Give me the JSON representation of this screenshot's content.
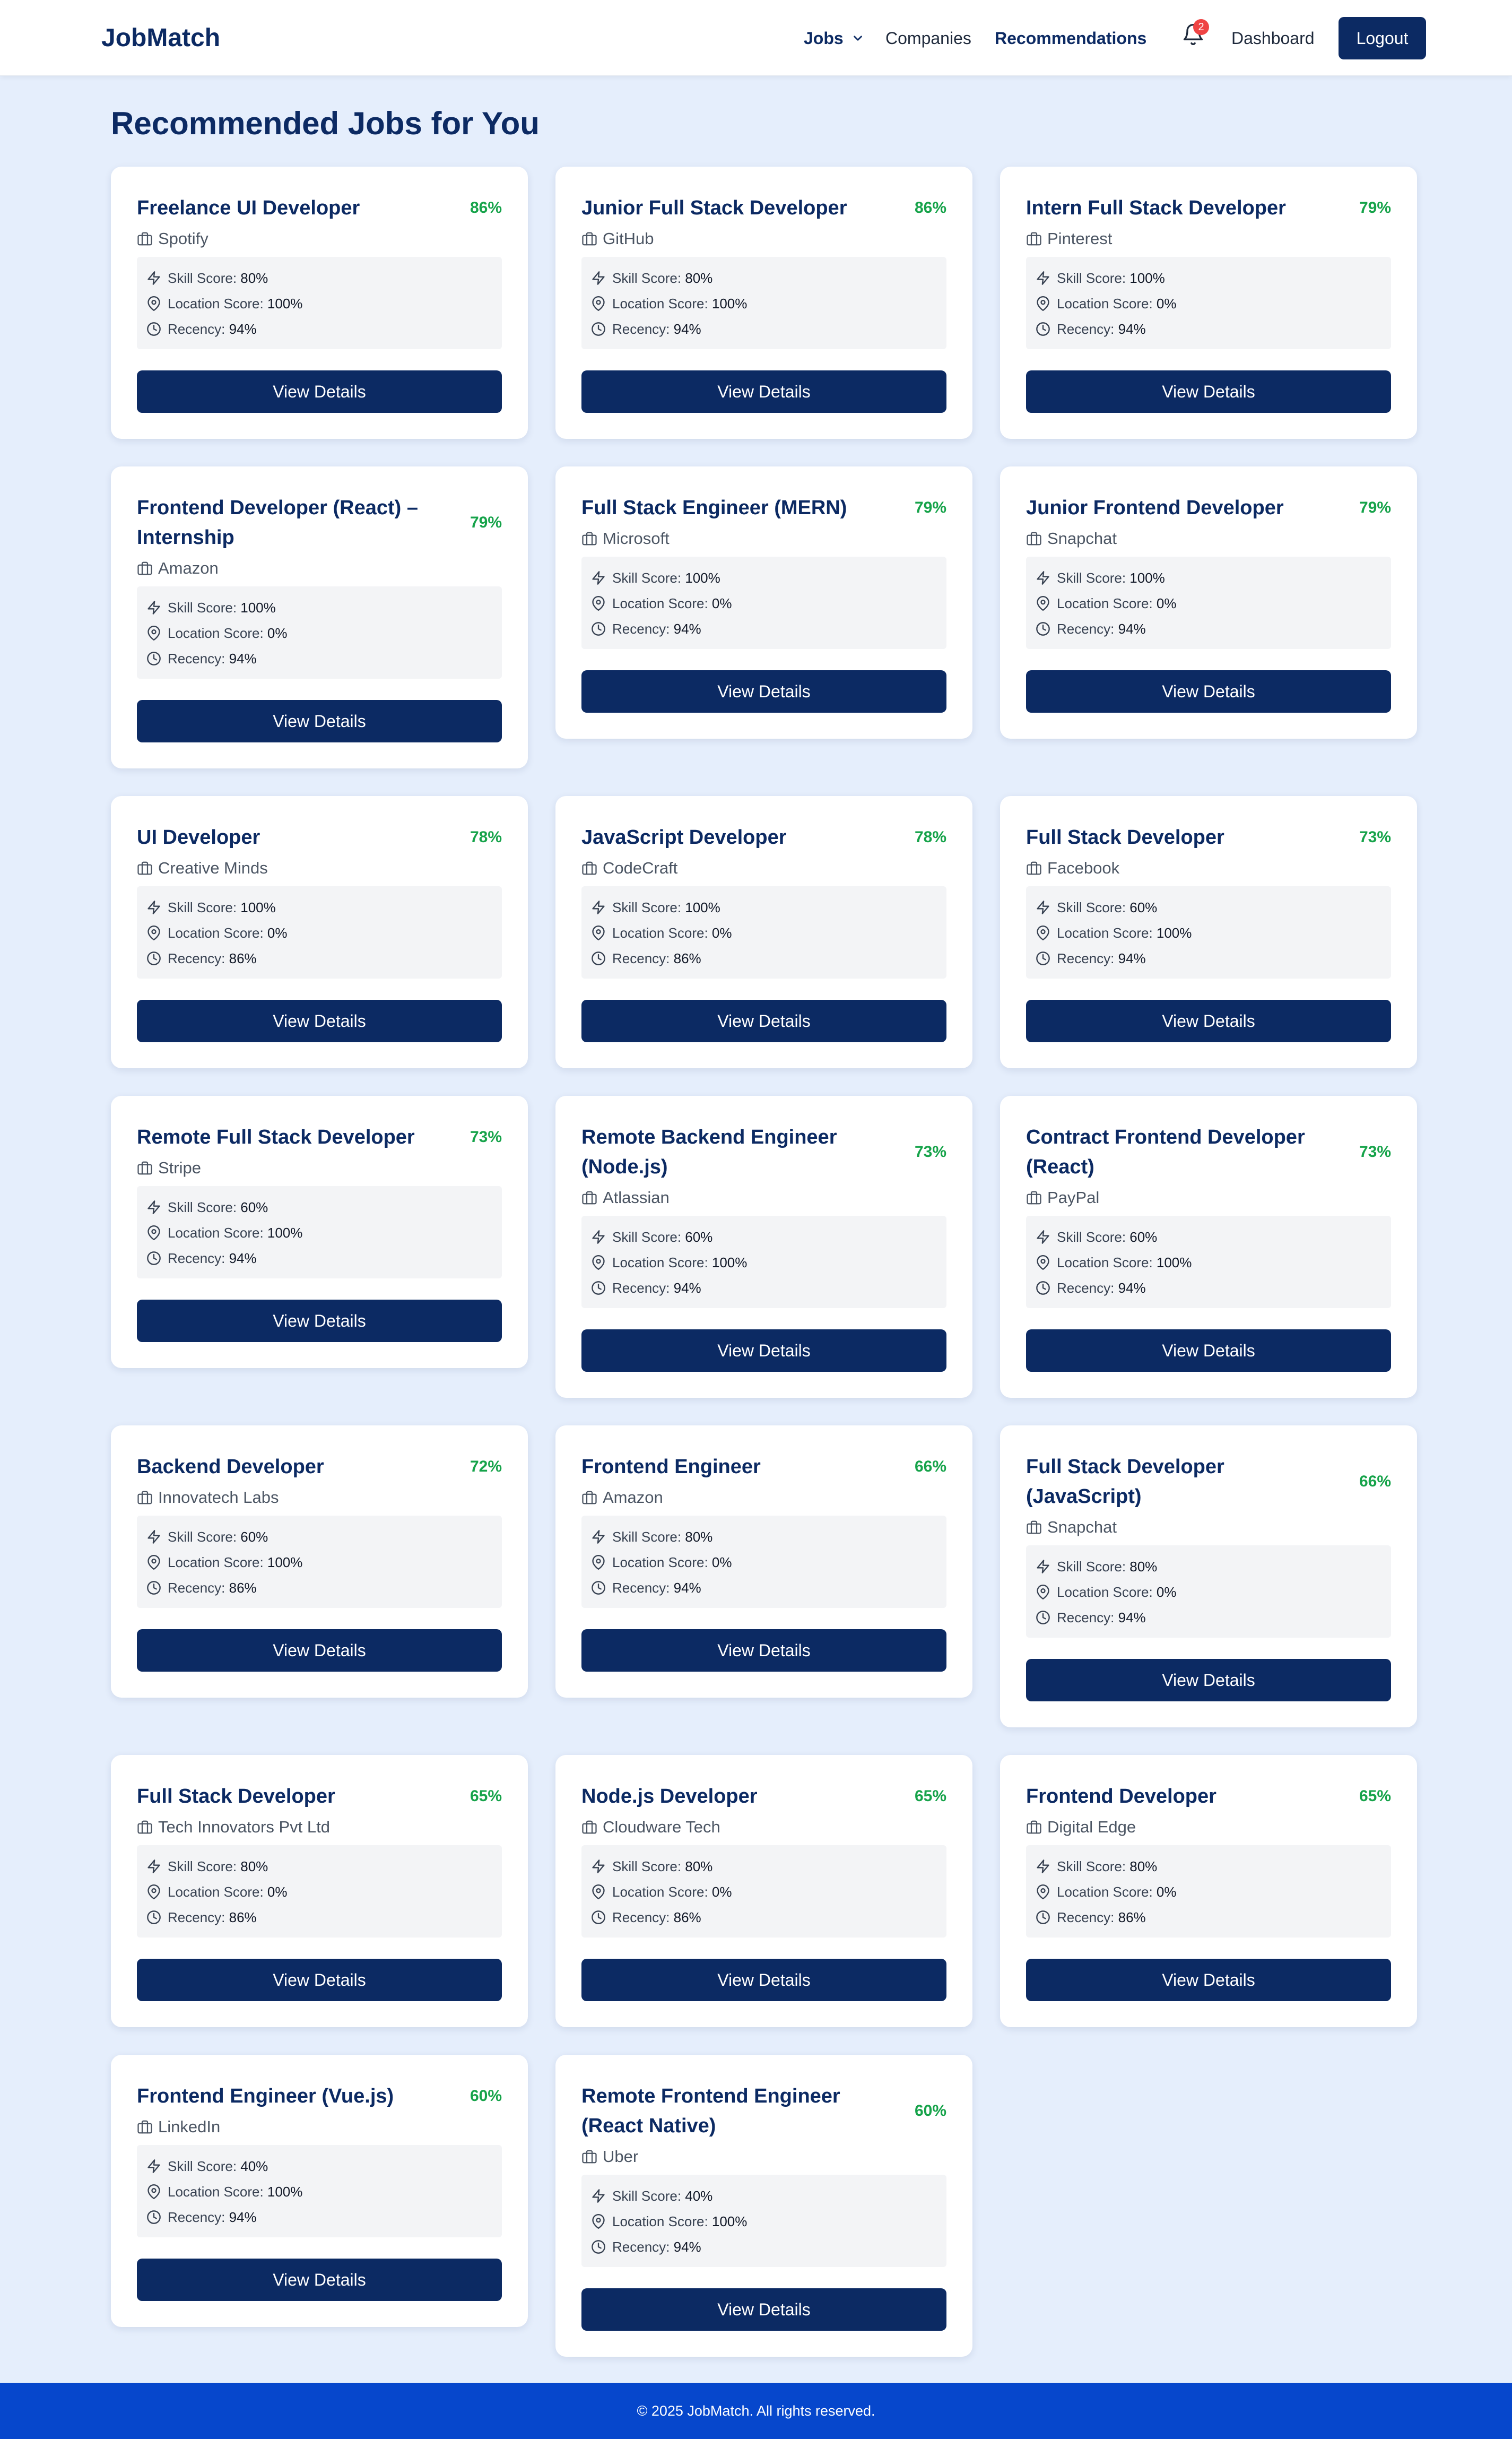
{
  "header": {
    "brand": "JobMatch",
    "nav": {
      "jobs": "Jobs",
      "companies": "Companies",
      "recommendations": "Recommendations",
      "dashboard": "Dashboard"
    },
    "notification_count": "2",
    "logout": "Logout"
  },
  "page": {
    "title": "Recommended Jobs for You"
  },
  "labels": {
    "skill": "Skill Score: ",
    "location": "Location Score: ",
    "recency": "Recency: ",
    "view_details": "View Details"
  },
  "jobs": [
    {
      "title": "Freelance UI Developer",
      "match": "86%",
      "company": "Spotify",
      "skill": "80%",
      "location": "100%",
      "recency": "94%"
    },
    {
      "title": "Junior Full Stack Developer",
      "match": "86%",
      "company": "GitHub",
      "skill": "80%",
      "location": "100%",
      "recency": "94%"
    },
    {
      "title": "Intern Full Stack Developer",
      "match": "79%",
      "company": "Pinterest",
      "skill": "100%",
      "location": "0%",
      "recency": "94%"
    },
    {
      "title": "Frontend Developer (React) – Internship",
      "match": "79%",
      "company": "Amazon",
      "skill": "100%",
      "location": "0%",
      "recency": "94%"
    },
    {
      "title": "Full Stack Engineer (MERN)",
      "match": "79%",
      "company": "Microsoft",
      "skill": "100%",
      "location": "0%",
      "recency": "94%"
    },
    {
      "title": "Junior Frontend Developer",
      "match": "79%",
      "company": "Snapchat",
      "skill": "100%",
      "location": "0%",
      "recency": "94%"
    },
    {
      "title": "UI Developer",
      "match": "78%",
      "company": "Creative Minds",
      "skill": "100%",
      "location": "0%",
      "recency": "86%"
    },
    {
      "title": "JavaScript Developer",
      "match": "78%",
      "company": "CodeCraft",
      "skill": "100%",
      "location": "0%",
      "recency": "86%"
    },
    {
      "title": "Full Stack Developer",
      "match": "73%",
      "company": "Facebook",
      "skill": "60%",
      "location": "100%",
      "recency": "94%"
    },
    {
      "title": "Remote Full Stack Developer",
      "match": "73%",
      "company": "Stripe",
      "skill": "60%",
      "location": "100%",
      "recency": "94%"
    },
    {
      "title": "Remote Backend Engineer (Node.js)",
      "match": "73%",
      "company": "Atlassian",
      "skill": "60%",
      "location": "100%",
      "recency": "94%"
    },
    {
      "title": "Contract Frontend Developer (React)",
      "match": "73%",
      "company": "PayPal",
      "skill": "60%",
      "location": "100%",
      "recency": "94%"
    },
    {
      "title": "Backend Developer",
      "match": "72%",
      "company": "Innovatech Labs",
      "skill": "60%",
      "location": "100%",
      "recency": "86%"
    },
    {
      "title": "Frontend Engineer",
      "match": "66%",
      "company": "Amazon",
      "skill": "80%",
      "location": "0%",
      "recency": "94%"
    },
    {
      "title": "Full Stack Developer (JavaScript)",
      "match": "66%",
      "company": "Snapchat",
      "skill": "80%",
      "location": "0%",
      "recency": "94%"
    },
    {
      "title": "Full Stack Developer",
      "match": "65%",
      "company": "Tech Innovators Pvt Ltd",
      "skill": "80%",
      "location": "0%",
      "recency": "86%"
    },
    {
      "title": "Node.js Developer",
      "match": "65%",
      "company": "Cloudware Tech",
      "skill": "80%",
      "location": "0%",
      "recency": "86%"
    },
    {
      "title": "Frontend Developer",
      "match": "65%",
      "company": "Digital Edge",
      "skill": "80%",
      "location": "0%",
      "recency": "86%"
    },
    {
      "title": "Frontend Engineer (Vue.js)",
      "match": "60%",
      "company": "LinkedIn",
      "skill": "40%",
      "location": "100%",
      "recency": "94%"
    },
    {
      "title": "Remote Frontend Engineer (React Native)",
      "match": "60%",
      "company": "Uber",
      "skill": "40%",
      "location": "100%",
      "recency": "94%"
    }
  ],
  "footer": {
    "text": "© 2025 JobMatch. All rights reserved."
  },
  "colors": {
    "primary": "#0c2a63",
    "match_green": "#16a34a",
    "page_bg": "#e5eefc",
    "footer_bg": "#0647cc",
    "badge_red": "#ef4444"
  },
  "icons": {
    "company": "briefcase-icon",
    "skill": "lightning-icon",
    "location": "map-pin-icon",
    "recency": "clock-icon",
    "notifications": "bell-icon",
    "jobs_dropdown": "chevron-down-icon"
  }
}
